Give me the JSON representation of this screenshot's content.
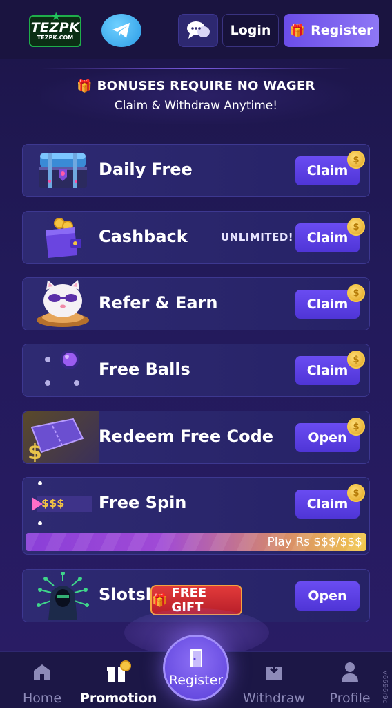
{
  "header": {
    "logo_text": "TEZPK",
    "logo_sub": "TEZPK.COM",
    "login_label": "Login",
    "register_label": "Register"
  },
  "banner": {
    "title": "BONUSES REQUIRE NO WAGER",
    "subtitle": "Claim & Withdraw Anytime!"
  },
  "promotions": [
    {
      "title": "Daily Free",
      "action": "Claim",
      "icon": "treasure-chest-icon"
    },
    {
      "title": "Cashback",
      "badge": "UNLIMITED!",
      "action": "Claim",
      "icon": "wallet-icon"
    },
    {
      "title": "Refer & Earn",
      "action": "Claim",
      "icon": "lucky-cat-icon"
    },
    {
      "title": "Free Balls",
      "action": "Claim",
      "icon": "balls-icon"
    },
    {
      "title": "Redeem Free Code",
      "action": "Open",
      "icon": "ticket-icon"
    },
    {
      "title": "Free Spin",
      "action": "Claim",
      "icon": "spin-arrow-icon",
      "pointer_label": "$$$",
      "progress_text": "Play Rs $$$/$$$"
    },
    {
      "title": "Slotsh",
      "action": "Open",
      "icon": "hacker-icon"
    }
  ],
  "free_gift_label": "FREE GIFT",
  "bottom_nav": {
    "home": "Home",
    "promotion": "Promotion",
    "register": "Register",
    "withdraw": "Withdraw",
    "profile": "Profile"
  },
  "side_id": "v6696r9c",
  "colors": {
    "accent": "#6a4cf2",
    "coin": "#f5c542",
    "gift_red": "#e23a3a"
  }
}
